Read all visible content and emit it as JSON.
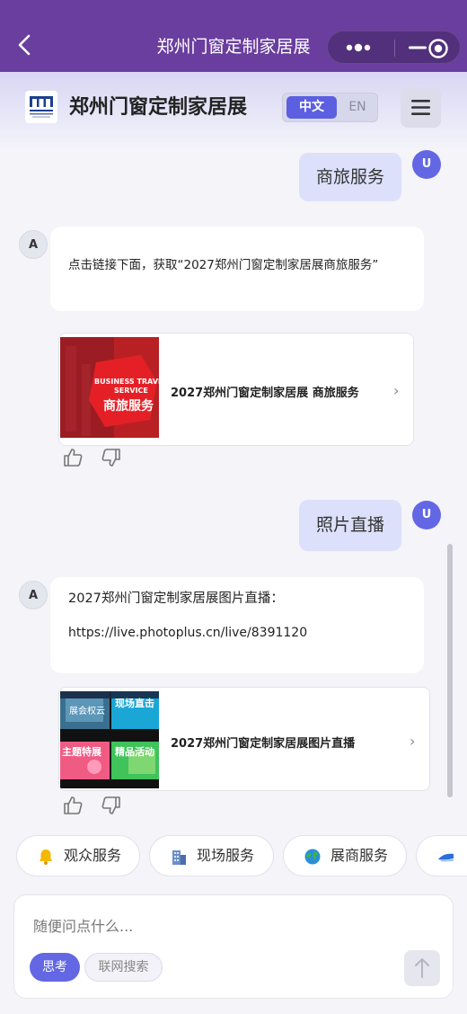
{
  "topbar": {
    "title": "郑州门窗定制家居展"
  },
  "header": {
    "brand": "郑州门窗定制家居展",
    "lang_zh": "中文",
    "lang_en": "EN"
  },
  "avatars": {
    "user": "U",
    "ai": "A"
  },
  "messages": [
    {
      "role": "user",
      "text": "商旅服务"
    },
    {
      "role": "ai",
      "text": "点击链接下面，获取“2027郑州门窗定制家居展商旅服务”",
      "card": {
        "title": "2027郑州门窗定制家居展 商旅服务",
        "thumb_line1": "BUSINESS TRAVE",
        "thumb_line2": "SERVICE",
        "thumb_line3": "商旅服务"
      }
    },
    {
      "role": "user",
      "text": "照片直播"
    },
    {
      "role": "ai",
      "text_line1": "2027郑州门窗定制家居展图片直播：",
      "text_line2": "https://live.photoplus.cn/live/8391120",
      "card": {
        "title": "2027郑州门窗定制家居展图片直播",
        "tiles": [
          "展会权云",
          "现场直击",
          "主题特展",
          "精品活动"
        ]
      }
    }
  ],
  "chips": [
    {
      "label": "观众服务",
      "icon": "bell-icon"
    },
    {
      "label": "现场服务",
      "icon": "building-icon"
    },
    {
      "label": "展商服务",
      "icon": "globe-icon"
    }
  ],
  "input": {
    "placeholder": "随便问点什么...",
    "think_label": "思考",
    "search_label": "联网搜索"
  },
  "colors": {
    "topbar": "#6a3e9e",
    "accent": "#5b5fe0",
    "user_bubble": "#dde0fa"
  }
}
